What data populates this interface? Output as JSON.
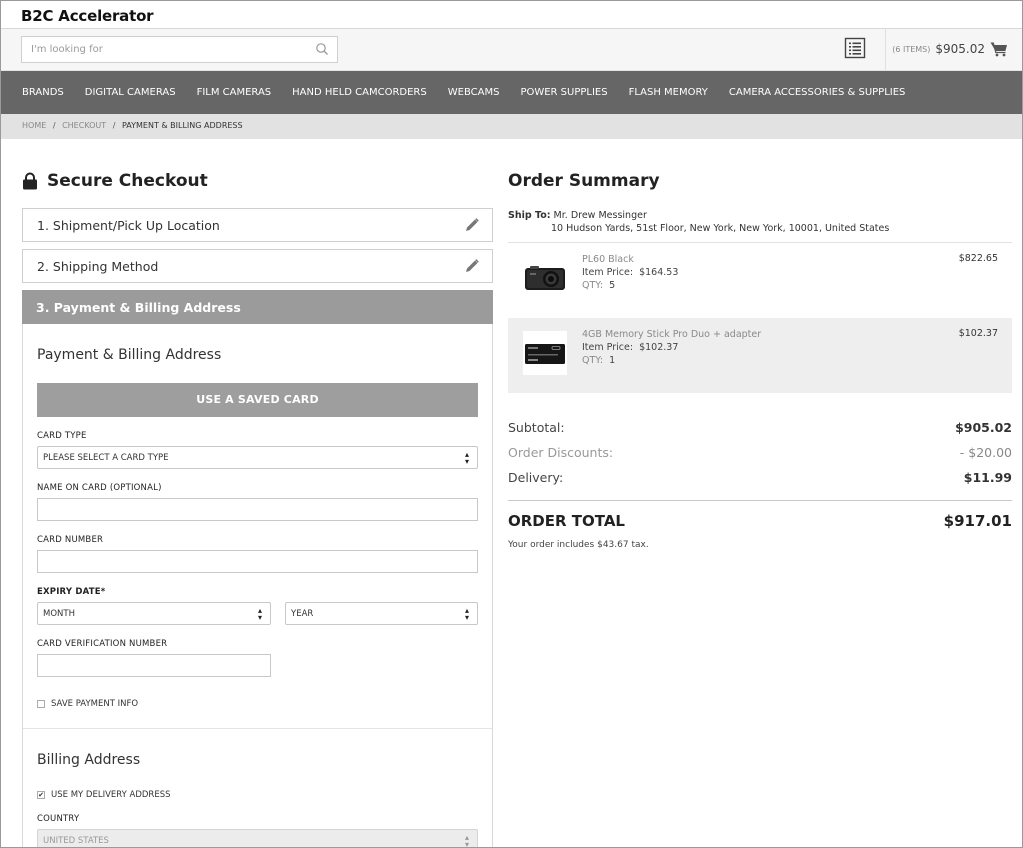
{
  "brand": "B2C Accelerator",
  "search": {
    "placeholder": "I'm looking for"
  },
  "cart": {
    "count": "(6 ITEMS)",
    "total": "$905.02"
  },
  "nav": [
    "BRANDS",
    "DIGITAL CAMERAS",
    "FILM CAMERAS",
    "HAND HELD CAMCORDERS",
    "WEBCAMS",
    "POWER SUPPLIES",
    "FLASH MEMORY",
    "CAMERA ACCESSORIES & SUPPLIES"
  ],
  "breadcrumb": {
    "home": "HOME",
    "checkout": "CHECKOUT",
    "current": "PAYMENT & BILLING ADDRESS",
    "sep": "/"
  },
  "checkout": {
    "title": "Secure Checkout",
    "step1": "1. Shipment/Pick Up Location",
    "step2": "2. Shipping Method",
    "step3": "3. Payment & Billing Address",
    "panel_title": "Payment & Billing Address",
    "saved_card": "USE A SAVED CARD",
    "card_type_label": "CARD TYPE",
    "card_type_value": "PLEASE SELECT A CARD TYPE",
    "name_label": "NAME ON CARD (OPTIONAL)",
    "name_value": "",
    "number_label": "CARD NUMBER",
    "number_value": "",
    "expiry_label": "EXPIRY DATE*",
    "month_value": "MONTH",
    "year_value": "YEAR",
    "cvn_label": "CARD VERIFICATION NUMBER",
    "cvn_value": "",
    "save_payment": "SAVE PAYMENT INFO",
    "save_payment_checked": false,
    "billing_title": "Billing Address",
    "use_delivery": "USE MY DELIVERY ADDRESS",
    "use_delivery_checked": true,
    "country_label": "COUNTRY",
    "country_value": "UNITED STATES"
  },
  "summary": {
    "title": "Order Summary",
    "ship_to_label": "Ship To:",
    "ship_to_name": "Mr. Drew Messinger",
    "ship_to_address": "10 Hudson Yards,  51st Floor,  New York,  New York,  10001,  United States",
    "items": [
      {
        "name": "PL60 Black",
        "item_price_label": "Item Price:",
        "item_price": "$164.53",
        "qty_label": "QTY:",
        "qty": "5",
        "total": "$822.65"
      },
      {
        "name": "4GB Memory Stick Pro Duo + adapter",
        "item_price_label": "Item Price:",
        "item_price": "$102.37",
        "qty_label": "QTY:",
        "qty": "1",
        "total": "$102.37"
      }
    ],
    "subtotal_label": "Subtotal:",
    "subtotal": "$905.02",
    "discounts_label": "Order Discounts:",
    "discounts": "- $20.00",
    "delivery_label": "Delivery:",
    "delivery": "$11.99",
    "order_total_label": "ORDER TOTAL",
    "order_total": "$917.01",
    "tax_note": "Your order includes $43.67 tax."
  },
  "icons": {
    "search": "search-icon",
    "list": "list-icon",
    "cart": "cart-icon",
    "lock": "lock-icon",
    "pencil": "pencil-icon"
  },
  "colors": {
    "nav_bg": "#666666",
    "active_step_bg": "#9b9b9b",
    "saved_card_bg": "#9e9e9e",
    "breadcrumb_bg": "#e2e2e2"
  }
}
